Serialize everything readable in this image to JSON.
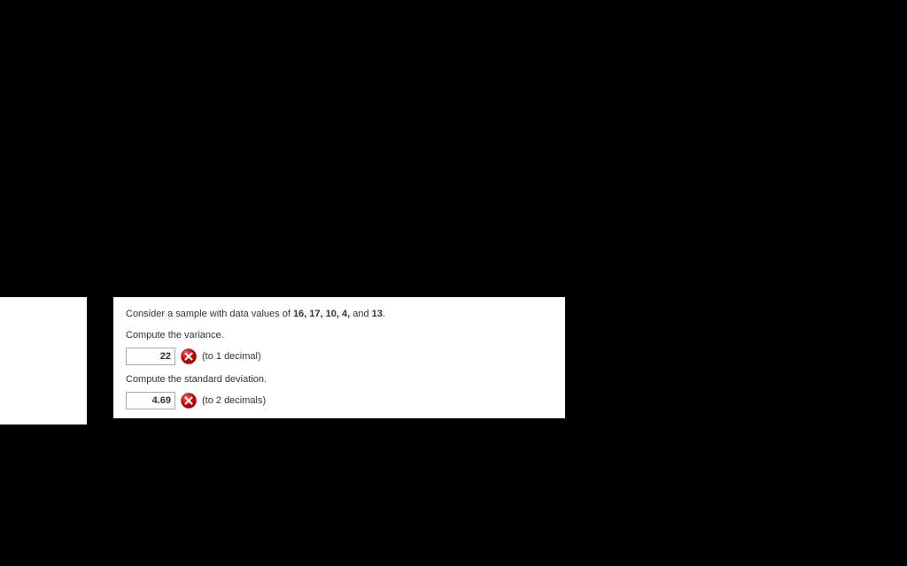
{
  "question": {
    "prompt_prefix": "Consider a sample with data values of ",
    "values_bold": "16, 17, 10, 4,",
    "values_mid": " and ",
    "values_last": "13",
    "prompt_suffix": "."
  },
  "part1": {
    "label": "Compute the variance.",
    "input_value": "22",
    "hint": "(to 1 decimal)"
  },
  "part2": {
    "label": "Compute the standard deviation.",
    "input_value": "4.69",
    "hint": "(to 2 decimals)"
  }
}
